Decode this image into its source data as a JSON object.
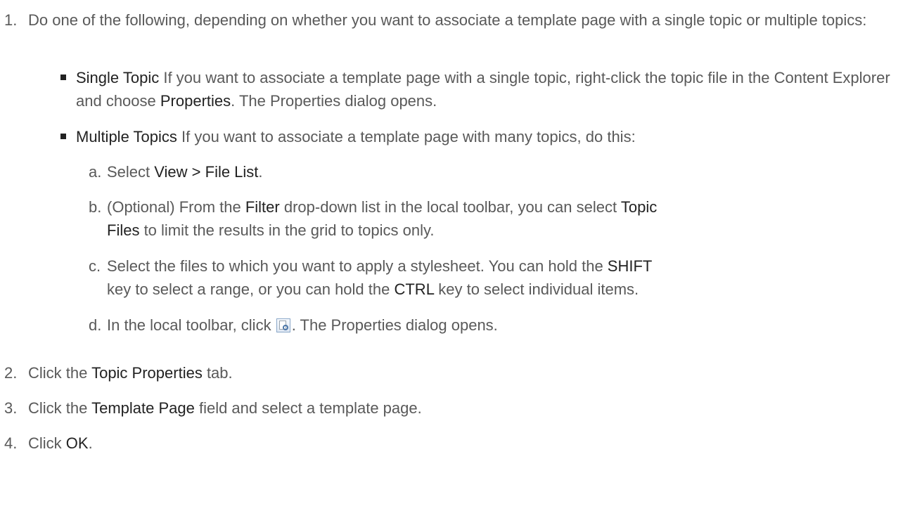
{
  "steps": [
    {
      "num": "1.",
      "text": "Do one of the following, depending on whether you want to associate a template page with a single topic or multiple topics:"
    },
    {
      "num": "2.",
      "pre": "Click the ",
      "bold": "Topic Properties",
      "post": " tab."
    },
    {
      "num": "3.",
      "pre": "Click the ",
      "bold": "Template Page",
      "post": " field and select a template page."
    },
    {
      "num": "4.",
      "pre": "Click ",
      "bold": "OK",
      "post": "."
    }
  ],
  "single": {
    "bold": "Single Topic",
    "pre": " If you want to associate a template page with a single topic, right-click the topic file in the Content Explorer and choose ",
    "bold2": "Properties",
    "post": ". The Properties dialog opens."
  },
  "multiple": {
    "bold": "Multiple Topics",
    "text": " If you want to associate a template page with many topics, do this:"
  },
  "substeps": {
    "a": {
      "letter": "a.",
      "pre": "Select ",
      "bold": "View > File List",
      "post": "."
    },
    "b": {
      "letter": "b.",
      "pre": "(Optional) From the ",
      "bold": "Filter",
      "mid": " drop-down list in the local toolbar, you can select ",
      "bold2a": "Topic",
      "bold2b": "Files",
      "post": " to limit the results in the grid to topics only."
    },
    "c": {
      "letter": "c.",
      "pre": "Select the files to which you want to apply a stylesheet. You can hold the ",
      "bold": "SHIFT",
      "mid": " key to select a range, or you can hold the ",
      "bold2": "CTRL",
      "post": " key to select individual items."
    },
    "d": {
      "letter": "d.",
      "pre": "In the local toolbar, click ",
      "post": ". The Properties dialog opens.",
      "icon": "properties-icon"
    }
  }
}
